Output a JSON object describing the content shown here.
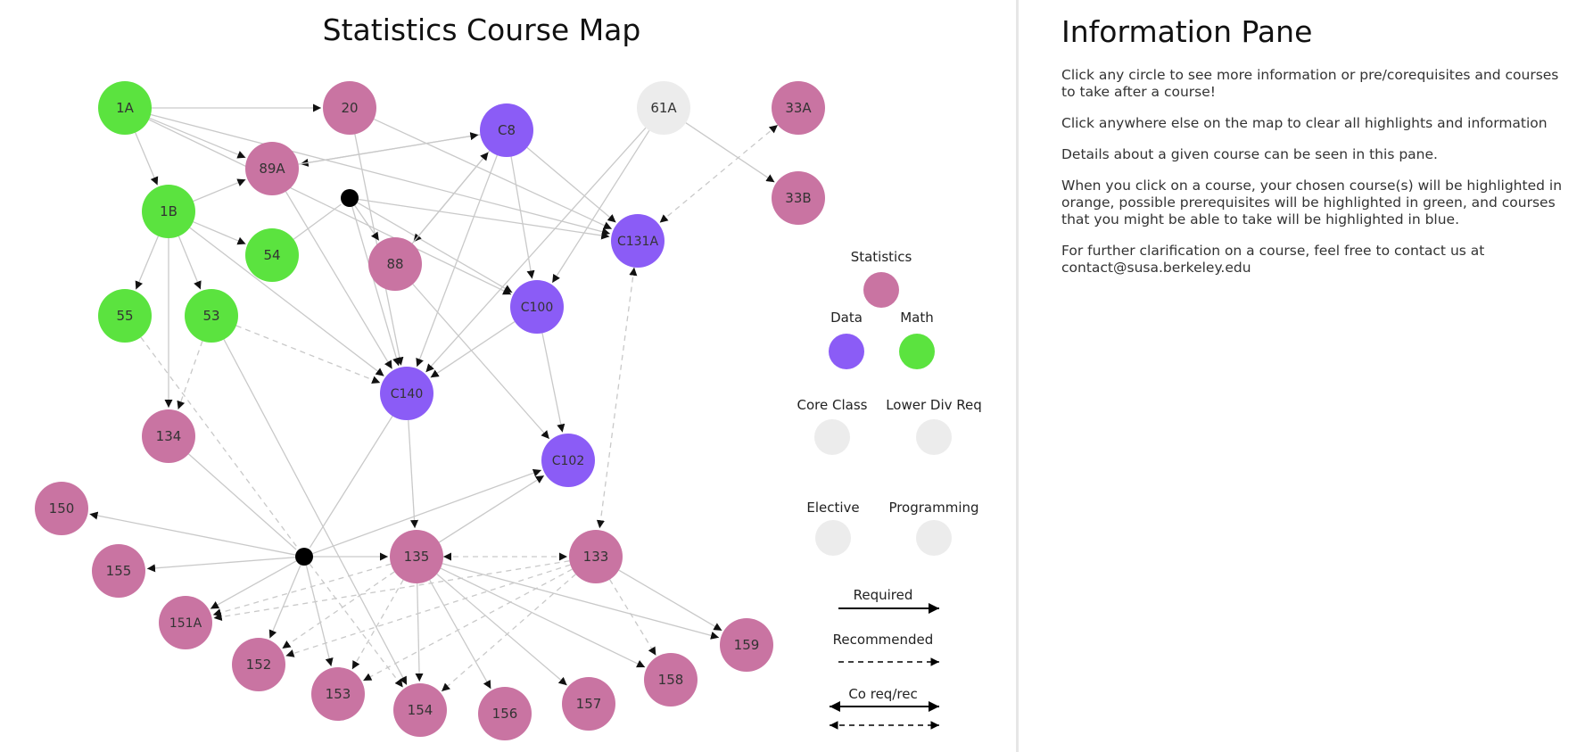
{
  "map": {
    "title": "Statistics Course Map",
    "nodes": [
      {
        "id": "1A",
        "label": "1A",
        "category": "Math"
      },
      {
        "id": "1B",
        "label": "1B",
        "category": "Math"
      },
      {
        "id": "54",
        "label": "54",
        "category": "Math"
      },
      {
        "id": "55",
        "label": "55",
        "category": "Math"
      },
      {
        "id": "53",
        "label": "53",
        "category": "Math"
      },
      {
        "id": "20",
        "label": "20",
        "category": "Statistics"
      },
      {
        "id": "89A",
        "label": "89A",
        "category": "Statistics"
      },
      {
        "id": "88",
        "label": "88",
        "category": "Statistics"
      },
      {
        "id": "C8",
        "label": "C8",
        "category": "Data"
      },
      {
        "id": "61A",
        "label": "61A",
        "category": "Programming"
      },
      {
        "id": "33A",
        "label": "33A",
        "category": "Statistics"
      },
      {
        "id": "33B",
        "label": "33B",
        "category": "Statistics"
      },
      {
        "id": "C131A",
        "label": "C131A",
        "category": "Data"
      },
      {
        "id": "C100",
        "label": "C100",
        "category": "Data"
      },
      {
        "id": "C140",
        "label": "C140",
        "category": "Data"
      },
      {
        "id": "C102",
        "label": "C102",
        "category": "Data"
      },
      {
        "id": "134",
        "label": "134",
        "category": "Statistics"
      },
      {
        "id": "150",
        "label": "150",
        "category": "Statistics"
      },
      {
        "id": "155",
        "label": "155",
        "category": "Statistics"
      },
      {
        "id": "151A",
        "label": "151A",
        "category": "Statistics"
      },
      {
        "id": "152",
        "label": "152",
        "category": "Statistics"
      },
      {
        "id": "153",
        "label": "153",
        "category": "Statistics"
      },
      {
        "id": "154",
        "label": "154",
        "category": "Statistics"
      },
      {
        "id": "135",
        "label": "135",
        "category": "Statistics"
      },
      {
        "id": "156",
        "label": "156",
        "category": "Statistics"
      },
      {
        "id": "157",
        "label": "157",
        "category": "Statistics"
      },
      {
        "id": "133",
        "label": "133",
        "category": "Statistics"
      },
      {
        "id": "158",
        "label": "158",
        "category": "Statistics"
      },
      {
        "id": "159",
        "label": "159",
        "category": "Statistics"
      },
      {
        "id": "J1",
        "label": "",
        "category": "Junction"
      },
      {
        "id": "J2",
        "label": "",
        "category": "Junction"
      }
    ],
    "edges": [
      {
        "from": "1A",
        "to": "20",
        "style": "required"
      },
      {
        "from": "1A",
        "to": "1B",
        "style": "required"
      },
      {
        "from": "1A",
        "to": "89A",
        "style": "required"
      },
      {
        "from": "1A",
        "to": "C131A",
        "style": "required"
      },
      {
        "from": "1A",
        "to": "C100",
        "style": "required"
      },
      {
        "from": "1B",
        "to": "89A",
        "style": "required"
      },
      {
        "from": "1B",
        "to": "54",
        "style": "required"
      },
      {
        "from": "1B",
        "to": "55",
        "style": "required"
      },
      {
        "from": "1B",
        "to": "53",
        "style": "required"
      },
      {
        "from": "1B",
        "to": "134",
        "style": "required"
      },
      {
        "from": "1B",
        "to": "C140",
        "style": "required"
      },
      {
        "from": "C8",
        "to": "89A",
        "style": "required"
      },
      {
        "from": "89A",
        "to": "C8",
        "style": "required"
      },
      {
        "from": "89A",
        "to": "C140",
        "style": "required"
      },
      {
        "from": "20",
        "to": "C140",
        "style": "required"
      },
      {
        "from": "20",
        "to": "C131A",
        "style": "required"
      },
      {
        "from": "54",
        "to": "J1",
        "style": "required"
      },
      {
        "from": "J1",
        "to": "88",
        "style": "required"
      },
      {
        "from": "J1",
        "to": "C140",
        "style": "required"
      },
      {
        "from": "J1",
        "to": "C100",
        "style": "required"
      },
      {
        "from": "J1",
        "to": "C131A",
        "style": "required"
      },
      {
        "from": "C8",
        "to": "88",
        "style": "required"
      },
      {
        "from": "88",
        "to": "C8",
        "style": "required"
      },
      {
        "from": "C8",
        "to": "C100",
        "style": "required"
      },
      {
        "from": "C8",
        "to": "C131A",
        "style": "required"
      },
      {
        "from": "C8",
        "to": "C140",
        "style": "required"
      },
      {
        "from": "88",
        "to": "C102",
        "style": "required"
      },
      {
        "from": "61A",
        "to": "C100",
        "style": "required"
      },
      {
        "from": "61A",
        "to": "C140",
        "style": "required"
      },
      {
        "from": "61A",
        "to": "33B",
        "style": "required"
      },
      {
        "from": "C100",
        "to": "C140",
        "style": "required"
      },
      {
        "from": "C100",
        "to": "C102",
        "style": "required"
      },
      {
        "from": "33A",
        "to": "C131A",
        "style": "corequisite"
      },
      {
        "from": "C131A",
        "to": "133",
        "style": "corequisite"
      },
      {
        "from": "53",
        "to": "C140",
        "style": "recommended"
      },
      {
        "from": "53",
        "to": "134",
        "style": "recommended"
      },
      {
        "from": "55",
        "to": "J2",
        "style": "recommended"
      },
      {
        "from": "134",
        "to": "J2",
        "style": "required"
      },
      {
        "from": "C140",
        "to": "J2",
        "style": "required"
      },
      {
        "from": "C140",
        "to": "135",
        "style": "required"
      },
      {
        "from": "J2",
        "to": "C102",
        "style": "required"
      },
      {
        "from": "J2",
        "to": "150",
        "style": "required"
      },
      {
        "from": "J2",
        "to": "155",
        "style": "required"
      },
      {
        "from": "J2",
        "to": "135",
        "style": "required"
      },
      {
        "from": "J2",
        "to": "151A",
        "style": "required"
      },
      {
        "from": "J2",
        "to": "152",
        "style": "required"
      },
      {
        "from": "J2",
        "to": "153",
        "style": "required"
      },
      {
        "from": "J2",
        "to": "154",
        "style": "recommended"
      },
      {
        "from": "53",
        "to": "154",
        "style": "required"
      },
      {
        "from": "135",
        "to": "C102",
        "style": "required"
      },
      {
        "from": "135",
        "to": "133",
        "style": "corequisite"
      },
      {
        "from": "135",
        "to": "151A",
        "style": "recommended"
      },
      {
        "from": "135",
        "to": "152",
        "style": "recommended"
      },
      {
        "from": "135",
        "to": "153",
        "style": "recommended"
      },
      {
        "from": "135",
        "to": "154",
        "style": "required"
      },
      {
        "from": "135",
        "to": "156",
        "style": "required"
      },
      {
        "from": "135",
        "to": "157",
        "style": "required"
      },
      {
        "from": "135",
        "to": "158",
        "style": "required"
      },
      {
        "from": "135",
        "to": "159",
        "style": "required"
      },
      {
        "from": "133",
        "to": "151A",
        "style": "recommended"
      },
      {
        "from": "133",
        "to": "152",
        "style": "recommended"
      },
      {
        "from": "133",
        "to": "153",
        "style": "recommended"
      },
      {
        "from": "133",
        "to": "154",
        "style": "recommended"
      },
      {
        "from": "133",
        "to": "158",
        "style": "recommended"
      },
      {
        "from": "133",
        "to": "159",
        "style": "required"
      }
    ]
  },
  "legend": {
    "statistics": "Statistics",
    "data": "Data",
    "math": "Math",
    "core_class": "Core Class",
    "lower_div_req": "Lower Div Req",
    "elective": "Elective",
    "programming": "Programming",
    "required": "Required",
    "recommended": "Recommended",
    "coreq": "Co req/rec"
  },
  "colors": {
    "Statistics": "#c974a2",
    "Data": "#8b5cf6",
    "Math": "#5be33f",
    "Programming": "#ececec",
    "Junction": "#000000",
    "edge": "#c9c9c9"
  },
  "info": {
    "title": "Information Pane",
    "paragraphs": [
      "Click any circle to see more information or pre/corequisites and courses to take after a course!",
      "Click anywhere else on the map to clear all highlights and information",
      "Details about a given course can be seen in this pane.",
      "When you click on a course, your chosen course(s) will be highlighted in orange, possible prerequisites will be highlighted in green, and courses that you might be able to take will be highlighted in blue.",
      "For further clarification on a course, feel free to contact us at contact@susa.berkeley.edu"
    ]
  }
}
